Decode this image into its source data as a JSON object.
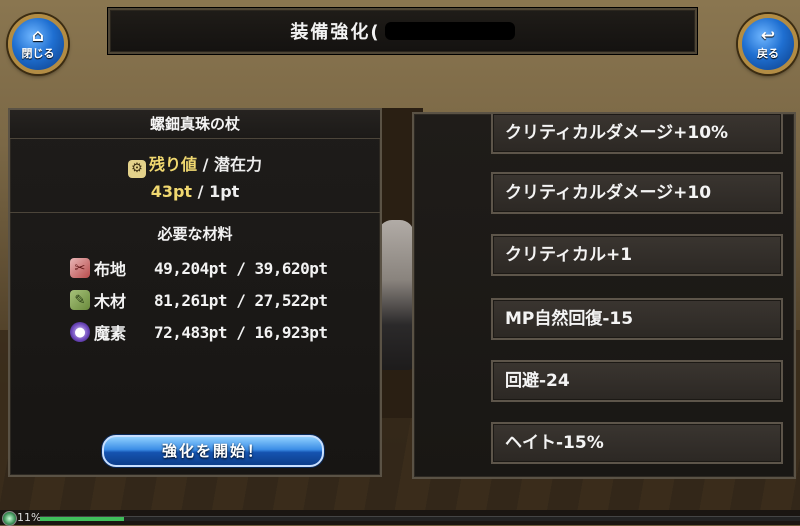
{
  "title_bar": {
    "text": "装備強化("
  },
  "buttons": {
    "close_label": "閉じる",
    "back_label": "戻る",
    "start_label": "強化を開始！"
  },
  "left_panel": {
    "item_name": "螺鈿真珠の杖",
    "stat_labels": {
      "remain": "残り値",
      "separator": "/",
      "potential": "潜在力"
    },
    "stat_values": {
      "remain": "43pt",
      "separator": "/",
      "potential": "1pt"
    },
    "materials_header": "必要な材料",
    "materials": [
      {
        "icon": "cloth-icon",
        "name": "布地",
        "value": "49,204pt / 39,620pt"
      },
      {
        "icon": "wood-icon",
        "name": "木材",
        "value": "81,261pt / 27,522pt"
      },
      {
        "icon": "magic-orb-icon",
        "name": "魔素",
        "value": "72,483pt / 16,923pt"
      }
    ]
  },
  "options": [
    "クリティカルダメージ+10%",
    "クリティカルダメージ+10",
    "クリティカル+1",
    "MP自然回復-15",
    "回避-24",
    "ヘイト-15%"
  ],
  "hud": {
    "percent_text": "11%",
    "progress": 0.11
  },
  "colors": {
    "gold_text": "#f0d870",
    "button_blue": "#1f6fd1",
    "frame_gold": "#b28c44"
  }
}
